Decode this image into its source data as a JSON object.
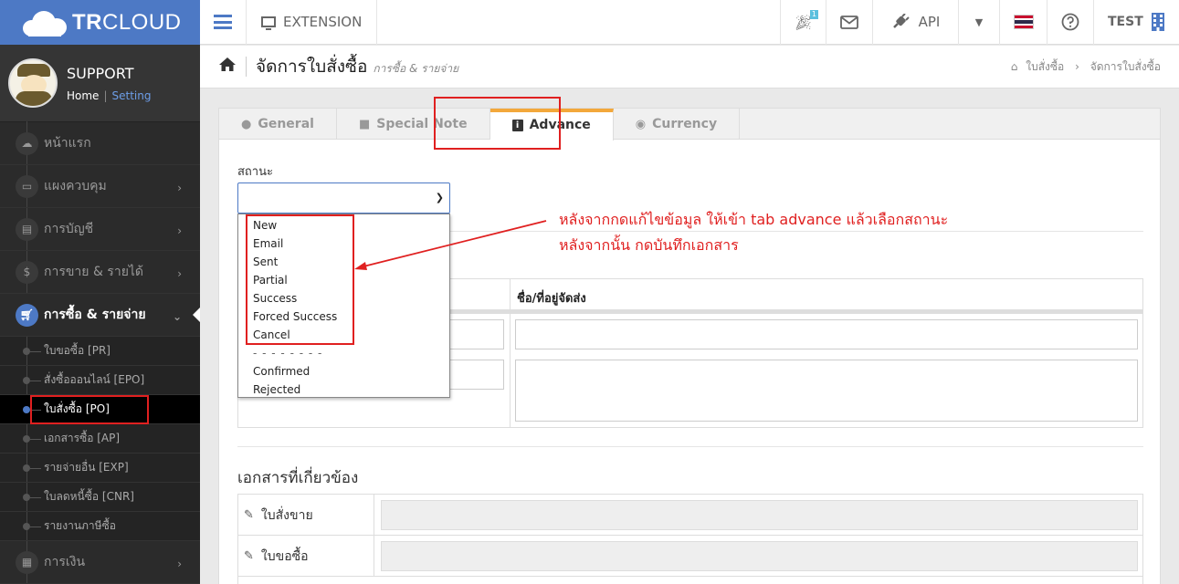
{
  "app": {
    "brand_bold": "TR",
    "brand_rest": "CLOUD"
  },
  "profile": {
    "name": "SUPPORT",
    "home_link": "Home",
    "separator": "|",
    "setting_link": "Setting"
  },
  "sidebar": {
    "items": [
      {
        "label": "หน้าแรก",
        "icon": "cloud-icon"
      },
      {
        "label": "แผงควบคุม",
        "icon": "monitor-icon"
      },
      {
        "label": "การบัญชี",
        "icon": "book-icon"
      },
      {
        "label": "การขาย & รายได้",
        "icon": "dollar-icon"
      },
      {
        "label": "การซื้อ & รายจ่าย",
        "icon": "cart-icon"
      },
      {
        "label": "การเงิน",
        "icon": "calendar-icon"
      }
    ],
    "sub_items": [
      "ใบขอซื้อ [PR]",
      "สั่งซื้อออนไลน์ [EPO]",
      "ใบสั่งซื้อ [PO]",
      "เอกสารซื้อ [AP]",
      "รายจ่ายอื่น [EXP]",
      "ใบลดหนี้ซื้อ [CNR]",
      "รายงานภาษีซื้อ"
    ]
  },
  "topbar": {
    "extension_label": "EXTENSION",
    "notification_count": "1",
    "api_label": "API",
    "company_label": "TEST"
  },
  "page": {
    "title": "จัดการใบสั่งซื้อ",
    "subtitle": "การซื้อ & รายจ่าย",
    "breadcrumb": [
      "ใบสั่งซื้อ",
      "จัดการใบสั่งซื้อ"
    ]
  },
  "tabs": [
    "General",
    "Special Note",
    "Advance",
    "Currency"
  ],
  "form": {
    "status_label": "สถานะ",
    "status_options": [
      "New",
      "Email",
      "Sent",
      "Partial",
      "Success",
      "Forced Success",
      "Cancel",
      "- - - - - - - -",
      "Confirmed",
      "Rejected"
    ],
    "shipping_header": "ชื่อ/ที่อยู่จัดส่ง"
  },
  "related": {
    "title": "เอกสารที่เกี่ยวข้อง",
    "rows": [
      "ใบสั่งขาย",
      "ใบขอซื้อ"
    ]
  },
  "annotation": {
    "line1": "หลังจากกดแก้ไขข้อมูล ให้เข้า tab advance แล้วเลือกสถานะ",
    "line2": "หลังจากนั้น กดบันทึกเอกสาร",
    "color": "#e02020"
  },
  "colors": {
    "brand": "#4d79c5",
    "sidebar_bg": "#2b2b2b",
    "tab_accent": "#f3a83b"
  }
}
